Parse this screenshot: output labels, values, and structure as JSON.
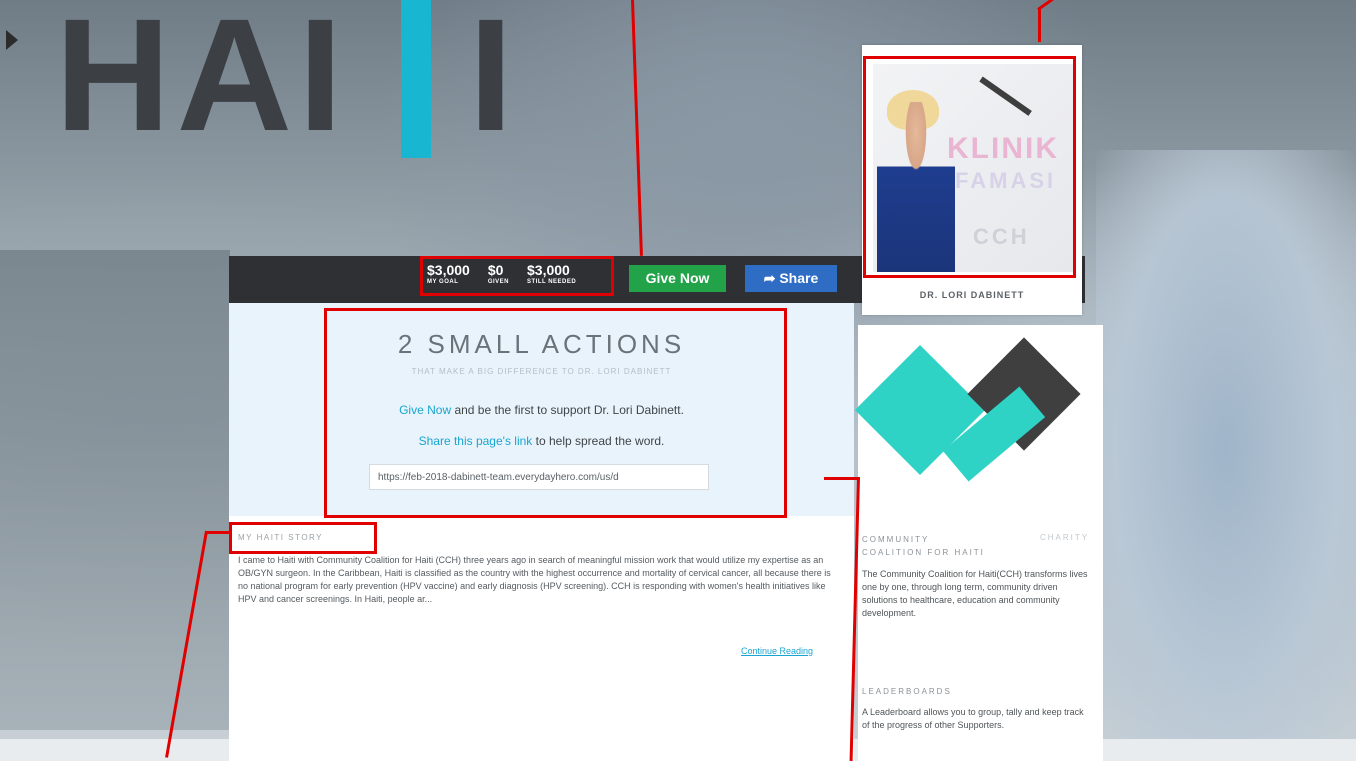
{
  "logo": {
    "letters_left": "HAI",
    "letter_right": "I"
  },
  "funding": {
    "goal_value": "$3,000",
    "goal_label": "MY GOAL",
    "given_value": "$0",
    "given_label": "GIVEN",
    "needed_value": "$3,000",
    "needed_label": "STILL NEEDED"
  },
  "buttons": {
    "give": "Give Now",
    "share": "Share"
  },
  "actions": {
    "title": "2 SMALL ACTIONS",
    "subtitle": "THAT MAKE A BIG DIFFERENCE TO DR. LORI DABINETT",
    "line1_link": "Give Now",
    "line1_text": " and be the first to support Dr. Lori Dabinett.",
    "line2_link": "Share this page's link",
    "line2_text": " to help spread the word.",
    "url": "https://feb-2018-dabinett-team.everydayhero.com/us/d"
  },
  "story": {
    "title": "MY HAITI STORY",
    "text": "I came to Haiti with Community Coalition for Haiti (CCH) three years ago in search of meaningful mission work that would utilize my expertise as an OB/GYN surgeon. In the Caribbean, Haiti is classified as the country with the highest occurrence and mortality of cervical cancer, all because there is no national program for early prevention (HPV vaccine) and early diagnosis (HPV screening). CCH is responding with women's health initiatives like HPV and cancer screenings. In Haiti, people ar...",
    "continue": "Continue Reading"
  },
  "profile": {
    "name": "DR. LORI DABINETT",
    "sign_top": "KLINIK",
    "sign_mid": "FAMASI",
    "sign_bottom": "CCH"
  },
  "charity": {
    "name_line1": "COMMUNITY",
    "name_line2": "COALITION FOR HAITI",
    "type": "CHARITY",
    "description": "The Community Coalition for Haiti(CCH) transforms lives one by one, through long term, community driven solutions to healthcare, education and community development."
  },
  "leaderboards": {
    "title": "LEADERBOARDS",
    "description": "A Leaderboard allows you to group, tally and keep track of the progress of other Supporters."
  },
  "colors": {
    "accent": "#19b6d1",
    "give": "#22a34a",
    "share": "#2f6cc3",
    "highlight": "#e00000"
  }
}
